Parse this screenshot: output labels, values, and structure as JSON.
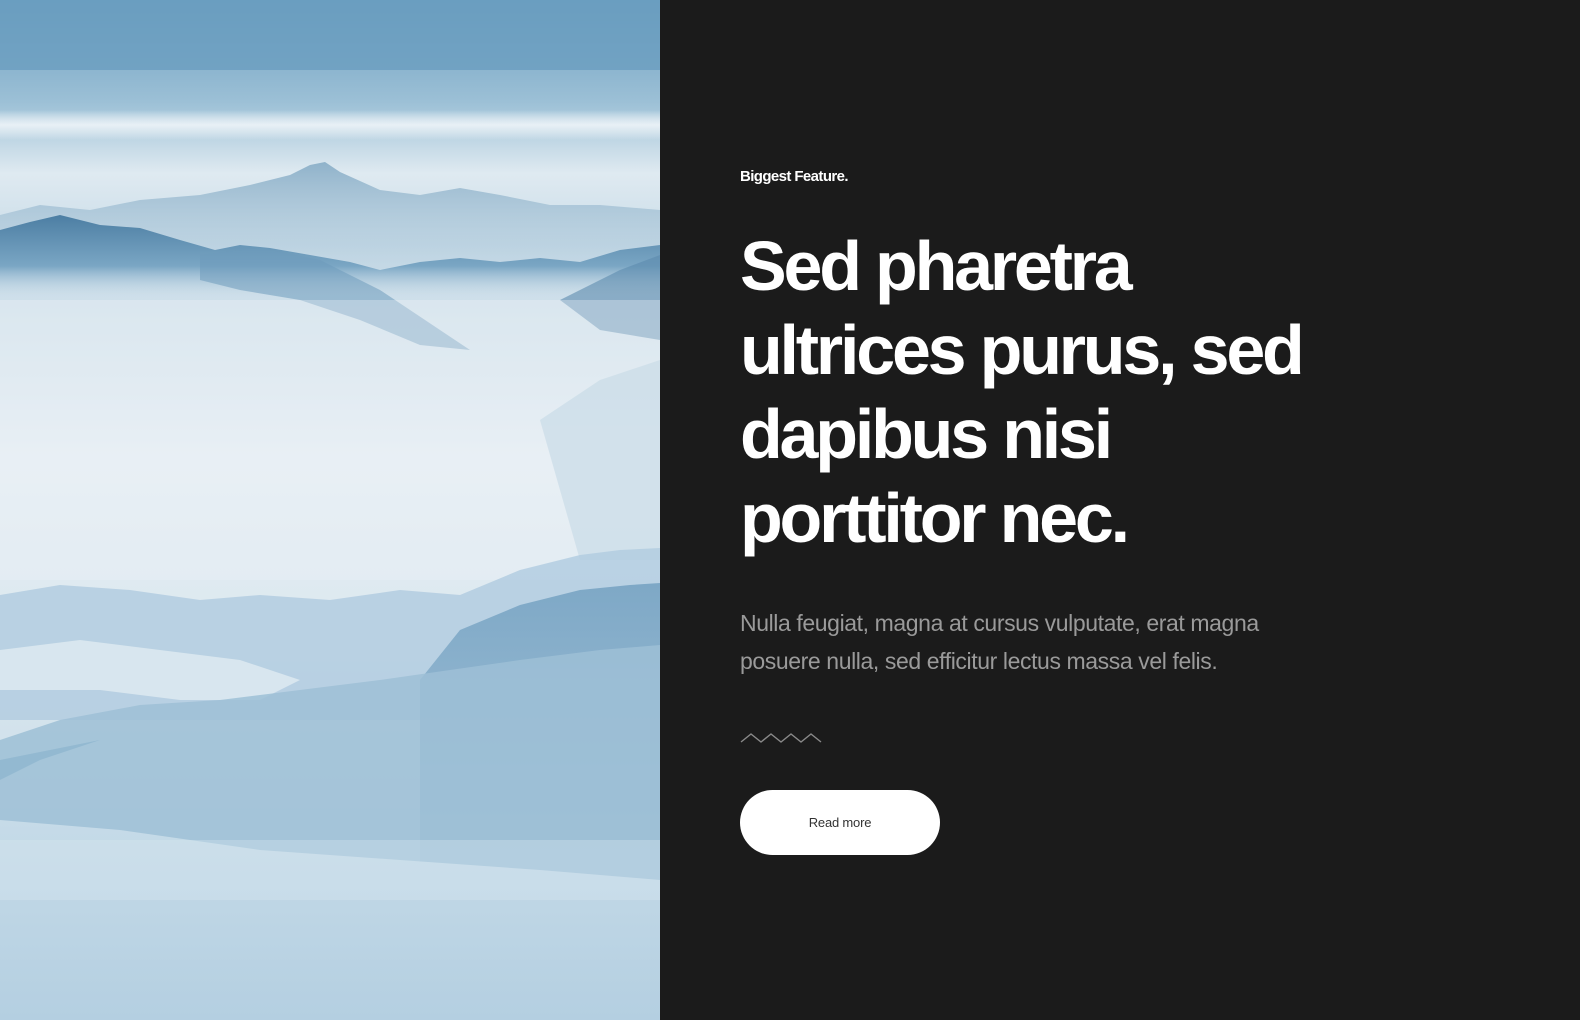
{
  "hero_image": {
    "alt": "misty blue mountain landscape",
    "colors": {
      "sky_top": "#6c9fc0",
      "haze": "#e4eef4",
      "ridge_dark": "#3f7096",
      "ridge_mid": "#7fa9c6",
      "lower_hills": "#8db4cf"
    }
  },
  "feature": {
    "eyebrow": "Biggest Feature.",
    "headline_lines": [
      "Sed pharetra",
      "ultrices purus, sed",
      "dapibus nisi",
      "porttitor nec."
    ],
    "body_lines": [
      "Nulla feugiat, magna at cursus vulputate, erat magna",
      "posuere nulla, sed efficitur lectus massa vel felis."
    ],
    "divider_icon": "zigzag-wave-icon",
    "button_label": "Read more"
  },
  "theme": {
    "background": "#1b1b1b",
    "heading_color": "#ffffff",
    "body_color": "#9a9a9a",
    "button_bg": "#ffffff",
    "button_text": "#333333"
  }
}
